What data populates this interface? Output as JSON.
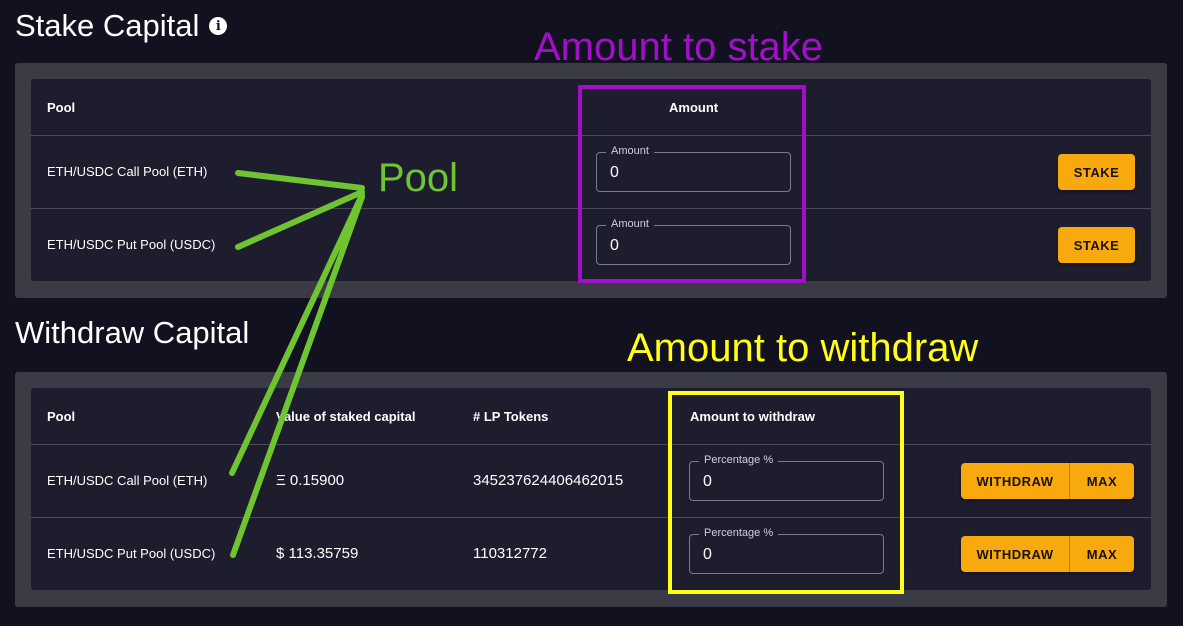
{
  "stake": {
    "title": "Stake Capital",
    "headers": {
      "pool": "Pool",
      "amount": "Amount"
    },
    "rows": [
      {
        "pool": "ETH/USDC Call Pool (ETH)",
        "amount_label": "Amount",
        "amount_value": "0",
        "button": "STAKE"
      },
      {
        "pool": "ETH/USDC Put Pool (USDC)",
        "amount_label": "Amount",
        "amount_value": "0",
        "button": "STAKE"
      }
    ]
  },
  "withdraw": {
    "title": "Withdraw Capital",
    "headers": {
      "pool": "Pool",
      "value": "Value of staked capital",
      "lp_tokens": "# LP Tokens",
      "amount": "Amount to withdraw"
    },
    "rows": [
      {
        "pool": "ETH/USDC Call Pool (ETH)",
        "value": "Ξ 0.15900",
        "lp_tokens": "345237624406462015",
        "pct_label": "Percentage %",
        "pct_value": "0",
        "withdraw_button": "WITHDRAW",
        "max_button": "MAX"
      },
      {
        "pool": "ETH/USDC Put Pool (USDC)",
        "value": "$ 113.35759",
        "lp_tokens": "110312772",
        "pct_label": "Percentage %",
        "pct_value": "0",
        "withdraw_button": "WITHDRAW",
        "max_button": "MAX"
      }
    ]
  },
  "annotations": {
    "amount_to_stake": "Amount to stake",
    "pool": "Pool",
    "amount_to_withdraw": "Amount to withdraw"
  },
  "colors": {
    "background": "#12111f",
    "panel": "#3a3b45",
    "card": "#1e1d2e",
    "button": "#f7a90d",
    "annotation_purple": "#a010c8",
    "annotation_green": "#6ec531",
    "annotation_yellow": "#ffff1a"
  },
  "icons": {
    "info": "info-icon"
  }
}
